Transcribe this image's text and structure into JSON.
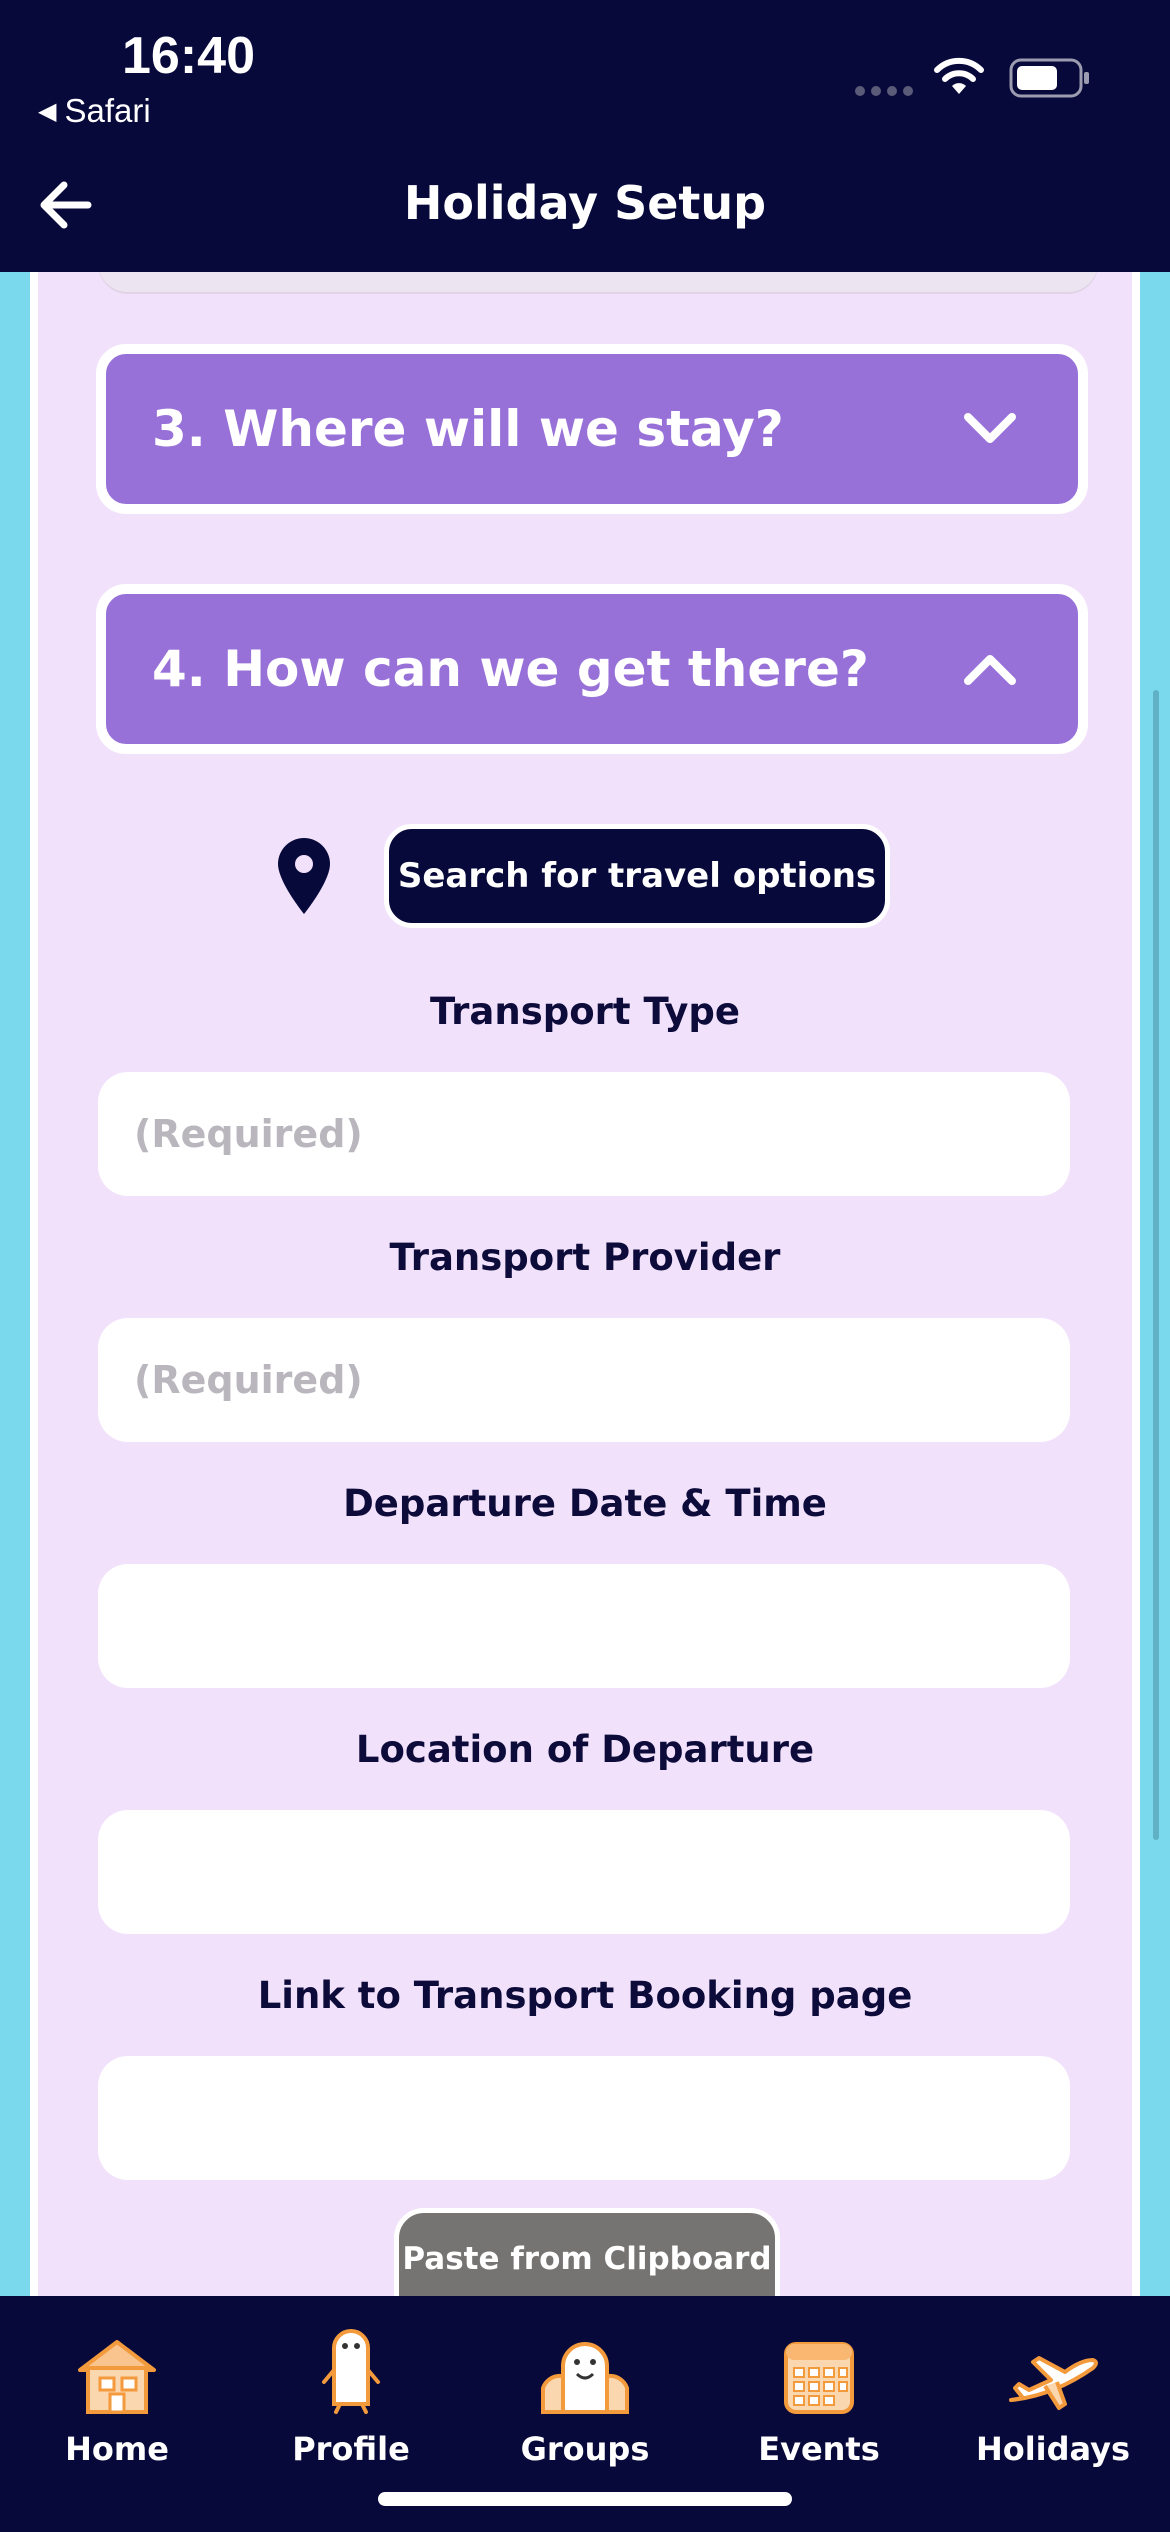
{
  "status_bar": {
    "time": "16:40",
    "back_app": "Safari"
  },
  "header": {
    "title": "Holiday Setup"
  },
  "sections": [
    {
      "label": "3. Where will we stay?",
      "state": "collapsed"
    },
    {
      "label": "4. How can we get there?",
      "state": "expanded"
    }
  ],
  "search_button": "Search for travel options",
  "fields": {
    "transport_type": {
      "label": "Transport Type",
      "placeholder": "(Required)",
      "value": ""
    },
    "transport_provider": {
      "label": "Transport Provider",
      "placeholder": "(Required)",
      "value": ""
    },
    "departure_datetime": {
      "label": "Departure Date & Time",
      "placeholder": "",
      "value": ""
    },
    "departure_location": {
      "label": "Location of Departure",
      "placeholder": "",
      "value": ""
    },
    "booking_link": {
      "label": "Link to Transport Booking page",
      "placeholder": "",
      "value": ""
    }
  },
  "paste_button": "Paste from Clipboard",
  "tabs": [
    {
      "label": "Home",
      "icon": "house-icon"
    },
    {
      "label": "Profile",
      "icon": "profile-icon"
    },
    {
      "label": "Groups",
      "icon": "groups-icon"
    },
    {
      "label": "Events",
      "icon": "calendar-icon"
    },
    {
      "label": "Holidays",
      "icon": "airplane-icon"
    }
  ],
  "colors": {
    "navy": "#08093b",
    "section_purple": "#9771d8",
    "panel_lavender": "#f2e1fb",
    "side_cyan": "#7ad9ec",
    "tab_icon_orange": "#f39a3c"
  }
}
